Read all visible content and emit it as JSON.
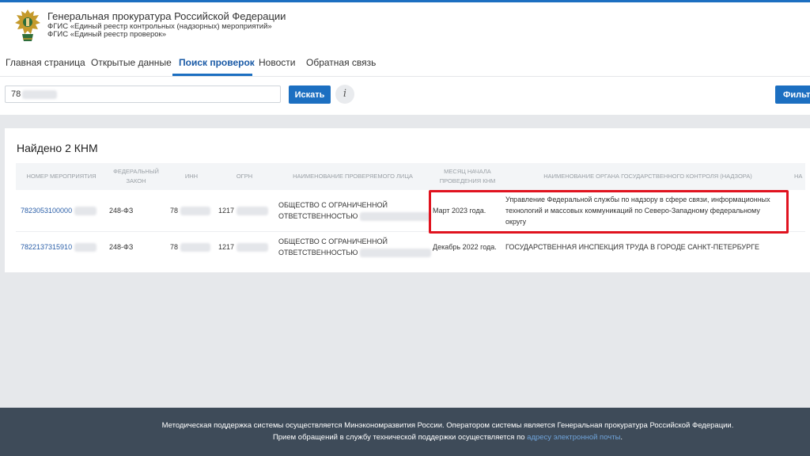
{
  "header": {
    "title": "Генеральная прокуратура Российской Федерации",
    "subtitle1": "ФГИС «Единый реестр контрольных (надзорных) мероприятий»",
    "subtitle2": "ФГИС «Единый реестр проверок»",
    "emblem_icon": "double-headed-eagle-emblem"
  },
  "nav": {
    "items": [
      {
        "label": "Главная страница"
      },
      {
        "label": "Открытые данные"
      },
      {
        "label": "Поиск проверок"
      },
      {
        "label": "Новости"
      },
      {
        "label": "Обратная связь"
      }
    ],
    "active_index": 2
  },
  "search": {
    "value": "78",
    "button_label": "Искать",
    "info_label": "i",
    "filter_label": "Фильтр"
  },
  "results": {
    "title": "Найдено 2 КНМ",
    "columns": [
      "Номер мероприятия",
      "Федеральный закон",
      "ИНН",
      "ОГРН",
      "Наименование проверяемого лица",
      "Месяц начала проведения КНМ",
      "Наименование органа государственного контроля (надзора)",
      "На"
    ],
    "rows": [
      {
        "number": "7823053100000",
        "law": "248-ФЗ",
        "inn": "78",
        "ogrn": "1217",
        "name_line1": "ОБЩЕСТВО С ОГРАНИЧЕННОЙ",
        "name_line2": "ОТВЕТСТВЕННОСТЬЮ",
        "month": "Март 2023 года.",
        "authority_line1": "Управление Федеральной службы по надзору в сфере связи, информационных",
        "authority_line2": "технологий и массовых коммуникаций по Северо-Западному федеральному",
        "authority_line3": "округу"
      },
      {
        "number": "7822137315910",
        "law": "248-ФЗ",
        "inn": "78",
        "ogrn": "1217",
        "name_line1": "ОБЩЕСТВО С ОГРАНИЧЕННОЙ",
        "name_line2": "ОТВЕТСТВЕННОСТЬЮ",
        "month": "Декабрь 2022 года.",
        "authority_line1": "ГОСУДАРСТВЕННАЯ ИНСПЕКЦИЯ ТРУДА В ГОРОДЕ САНКТ-ПЕТЕРБУРГЕ"
      }
    ],
    "highlight_color": "#e0131f"
  },
  "footer": {
    "line1": "Методическая поддержка системы осуществляется Минэкономразвития России. Оператором системы является Генеральная прокуратура Российской Федерации.",
    "line2": "Прием обращений в службу технической поддержки осуществляется по",
    "link": "адресу электронной почты",
    "line2_end": "."
  },
  "colors": {
    "accent": "#1c6fc1",
    "footer_bg": "#3e4b59",
    "link": "#2a5ea8"
  }
}
